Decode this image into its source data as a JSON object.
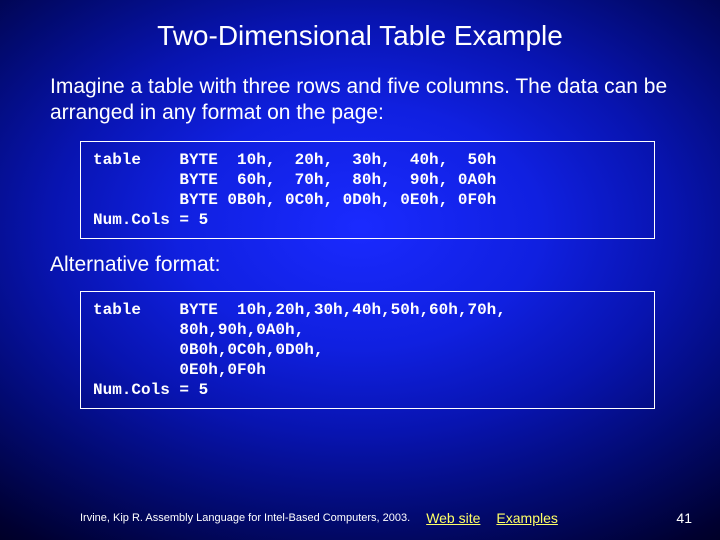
{
  "title": "Two-Dimensional Table Example",
  "intro": "Imagine a table with three rows and five columns. The data can be arranged in any format on the page:",
  "code1": "table    BYTE  10h,  20h,  30h,  40h,  50h\n         BYTE  60h,  70h,  80h,  90h, 0A0h\n         BYTE 0B0h, 0C0h, 0D0h, 0E0h, 0F0h\nNum.Cols = 5",
  "alt_label": "Alternative format:",
  "code2": "table    BYTE  10h,20h,30h,40h,50h,60h,70h,\n         80h,90h,0A0h,\n         0B0h,0C0h,0D0h,\n         0E0h,0F0h\nNum.Cols = 5",
  "footer": {
    "credit": "Irvine, Kip R. Assembly Language for Intel-Based Computers, 2003.",
    "link1": "Web site",
    "link2": "Examples",
    "page": "41"
  }
}
